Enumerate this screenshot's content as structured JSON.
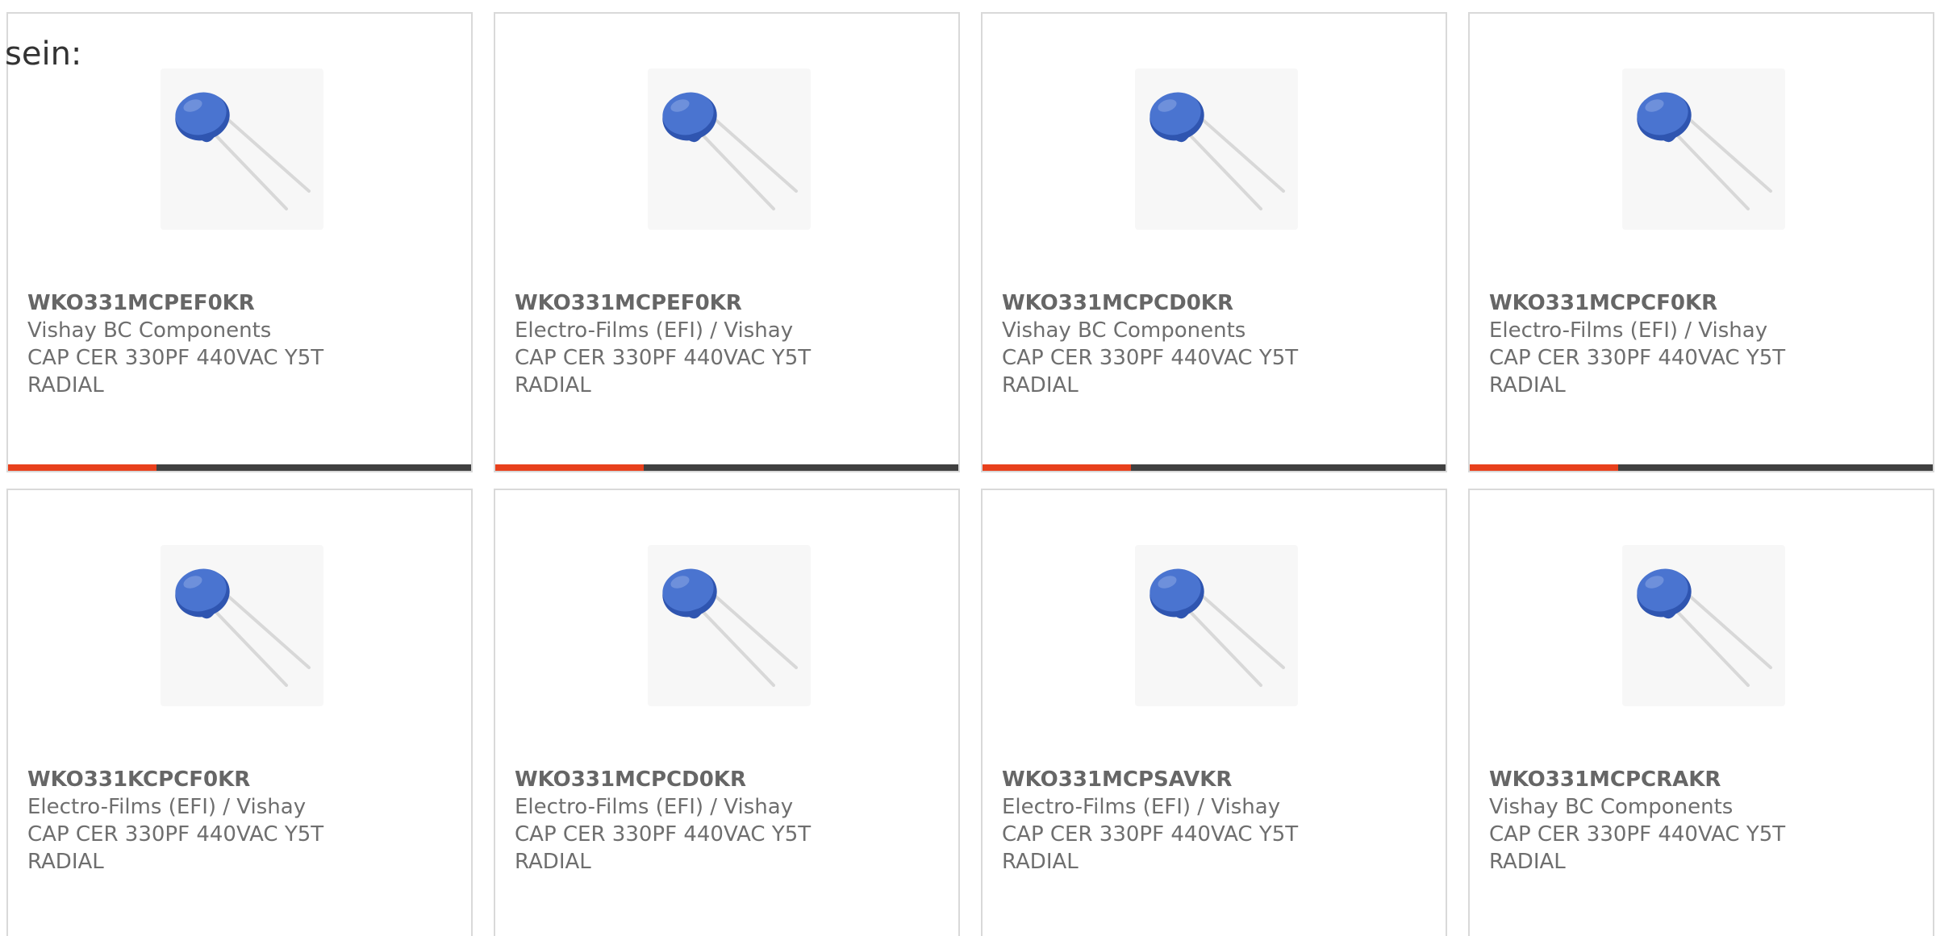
{
  "intro_text": "sein:",
  "colors": {
    "accent": "#e8401c",
    "bar": "#404040",
    "border": "#d9d9d9",
    "capacitor_body": "#3f68c4"
  },
  "product_image_icon": "blue-radial-ceramic-capacitor-icon",
  "products": [
    {
      "part_number": "WKO331MCPEF0KR",
      "manufacturer": "Vishay BC Components",
      "description": "CAP CER 330PF 440VAC Y5T RADIAL"
    },
    {
      "part_number": "WKO331MCPEF0KR",
      "manufacturer": "Electro-Films (EFI) / Vishay",
      "description": "CAP CER 330PF 440VAC Y5T RADIAL"
    },
    {
      "part_number": "WKO331MCPCD0KR",
      "manufacturer": "Vishay BC Components",
      "description": "CAP CER 330PF 440VAC Y5T RADIAL"
    },
    {
      "part_number": "WKO331MCPCF0KR",
      "manufacturer": "Electro-Films (EFI) / Vishay",
      "description": "CAP CER 330PF 440VAC Y5T RADIAL"
    },
    {
      "part_number": "WKO331KCPCF0KR",
      "manufacturer": "Electro-Films (EFI) / Vishay",
      "description": "CAP CER 330PF 440VAC Y5T RADIAL"
    },
    {
      "part_number": "WKO331MCPCD0KR",
      "manufacturer": "Electro-Films (EFI) / Vishay",
      "description": "CAP CER 330PF 440VAC Y5T RADIAL"
    },
    {
      "part_number": "WKO331MCPSAVKR",
      "manufacturer": "Electro-Films (EFI) / Vishay",
      "description": "CAP CER 330PF 440VAC Y5T RADIAL"
    },
    {
      "part_number": "WKO331MCPCRAKR",
      "manufacturer": "Vishay BC Components",
      "description": "CAP CER 330PF 440VAC Y5T RADIAL"
    }
  ]
}
